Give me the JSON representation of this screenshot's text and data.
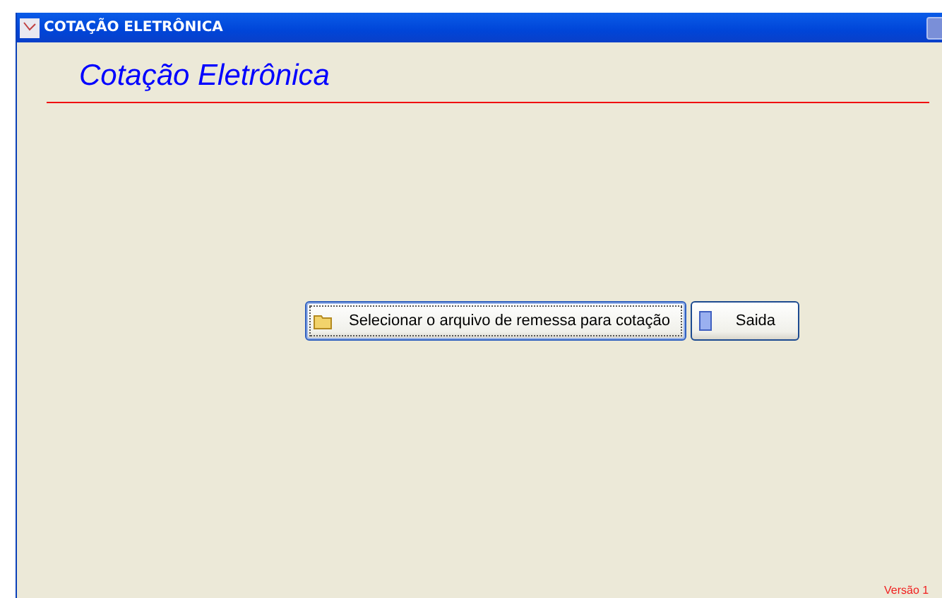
{
  "window": {
    "title": "COTAÇÃO ELETRÔNICA"
  },
  "heading": "Cotação Eletrônica",
  "buttons": [
    {
      "kind": "folder",
      "label": "Selecionar o arquivo de remessa para cotação",
      "focused": true
    },
    {
      "kind": "door",
      "label": "Saida",
      "focused": false
    }
  ],
  "version": "Versão 1"
}
